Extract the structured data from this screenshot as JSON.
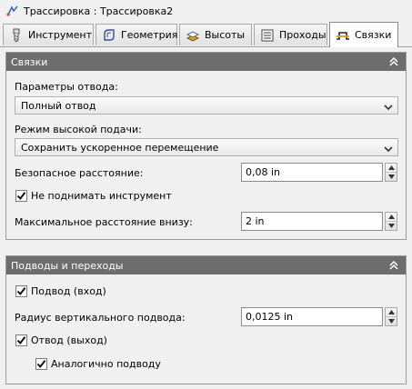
{
  "window": {
    "title": "Трассировка : Трассировка2",
    "icon": "toolpath-icon"
  },
  "tabs": [
    {
      "label": "Инструмент",
      "icon": "tool-icon",
      "active": false
    },
    {
      "label": "Геометрия",
      "icon": "geometry-icon",
      "active": false
    },
    {
      "label": "Высоты",
      "icon": "heights-icon",
      "active": false
    },
    {
      "label": "Проходы",
      "icon": "passes-icon",
      "active": false
    },
    {
      "label": "Связки",
      "icon": "linking-icon",
      "active": true
    }
  ],
  "linking": {
    "title": "Связки",
    "retract_label": "Параметры отвода:",
    "retract_value": "Полный отвод",
    "feed_label": "Режим высокой подачи:",
    "feed_value": "Сохранить ускоренное перемещение",
    "safe_label": "Безопасное расстояние:",
    "safe_value": "0,08 in",
    "keep_down_label": "Не поднимать инструмент",
    "keep_down_checked": true,
    "max_down_label": "Максимальное расстояние внизу:",
    "max_down_value": "2 in"
  },
  "leads": {
    "title": "Подводы и переходы",
    "lead_in_label": "Подвод (вход)",
    "lead_in_checked": true,
    "vertical_label": "Радиус вертикального подвода:",
    "vertical_value": "0,0125 in",
    "lead_out_label": "Отвод (выход)",
    "lead_out_checked": true,
    "same_label": "Аналогично подводу",
    "same_checked": true
  },
  "colors": {
    "panel_header": "#6d6d6d",
    "background": "#f0f0f0",
    "active_tab": "#ffffff"
  }
}
